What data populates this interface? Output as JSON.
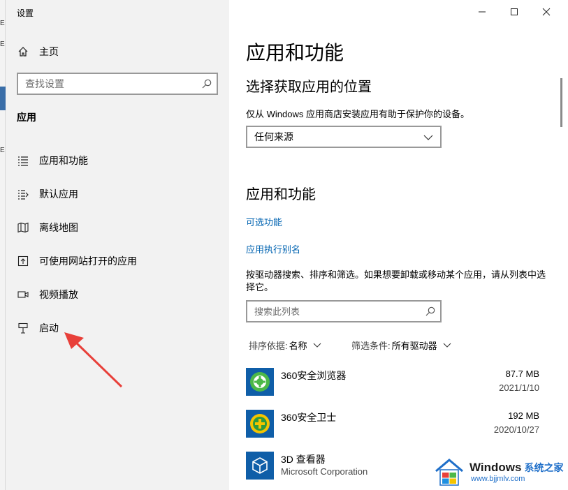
{
  "window": {
    "title": "设置"
  },
  "sidebar": {
    "home_label": "主页",
    "search_placeholder": "查找设置",
    "section_heading": "应用",
    "items": [
      {
        "label": "应用和功能",
        "icon": "list-icon"
      },
      {
        "label": "默认应用",
        "icon": "default-apps-icon"
      },
      {
        "label": "离线地图",
        "icon": "map-icon"
      },
      {
        "label": "可使用网站打开的应用",
        "icon": "open-external-icon"
      },
      {
        "label": "视频播放",
        "icon": "video-icon"
      },
      {
        "label": "启动",
        "icon": "startup-icon"
      }
    ]
  },
  "content": {
    "page_title": "应用和功能",
    "choose_location_heading": "选择获取应用的位置",
    "choose_location_desc": "仅从 Windows 应用商店安装应用有助于保护你的设备。",
    "source_dropdown_value": "任何来源",
    "apps_heading": "应用和功能",
    "links": {
      "optional_features": "可选功能",
      "app_aliases": "应用执行别名"
    },
    "search_desc": "按驱动器搜索、排序和筛选。如果想要卸载或移动某个应用，请从列表中选择它。",
    "list_search_placeholder": "搜索此列表",
    "sort": {
      "label": "排序依据:",
      "value": "名称"
    },
    "filter": {
      "label": "筛选条件:",
      "value": "所有驱动器"
    },
    "apps": [
      {
        "name": "360安全浏览器",
        "publisher": "",
        "size": "87.7 MB",
        "date": "2021/1/10",
        "icon": "browser-360-icon"
      },
      {
        "name": "360安全卫士",
        "publisher": "",
        "size": "192 MB",
        "date": "2020/10/27",
        "icon": "security-360-icon"
      },
      {
        "name": "3D 查看器",
        "publisher": "Microsoft Corporation",
        "size": "",
        "date": "",
        "icon": "cube-icon"
      }
    ]
  },
  "watermark": {
    "title": "Windows",
    "title2": "系统之家",
    "url": "www.bjjmlv.com"
  },
  "colors": {
    "sidebar_bg": "#f2f2f2",
    "link": "#0063b1",
    "app_tile": "#0f5ea8",
    "arrow": "#e8403a"
  }
}
